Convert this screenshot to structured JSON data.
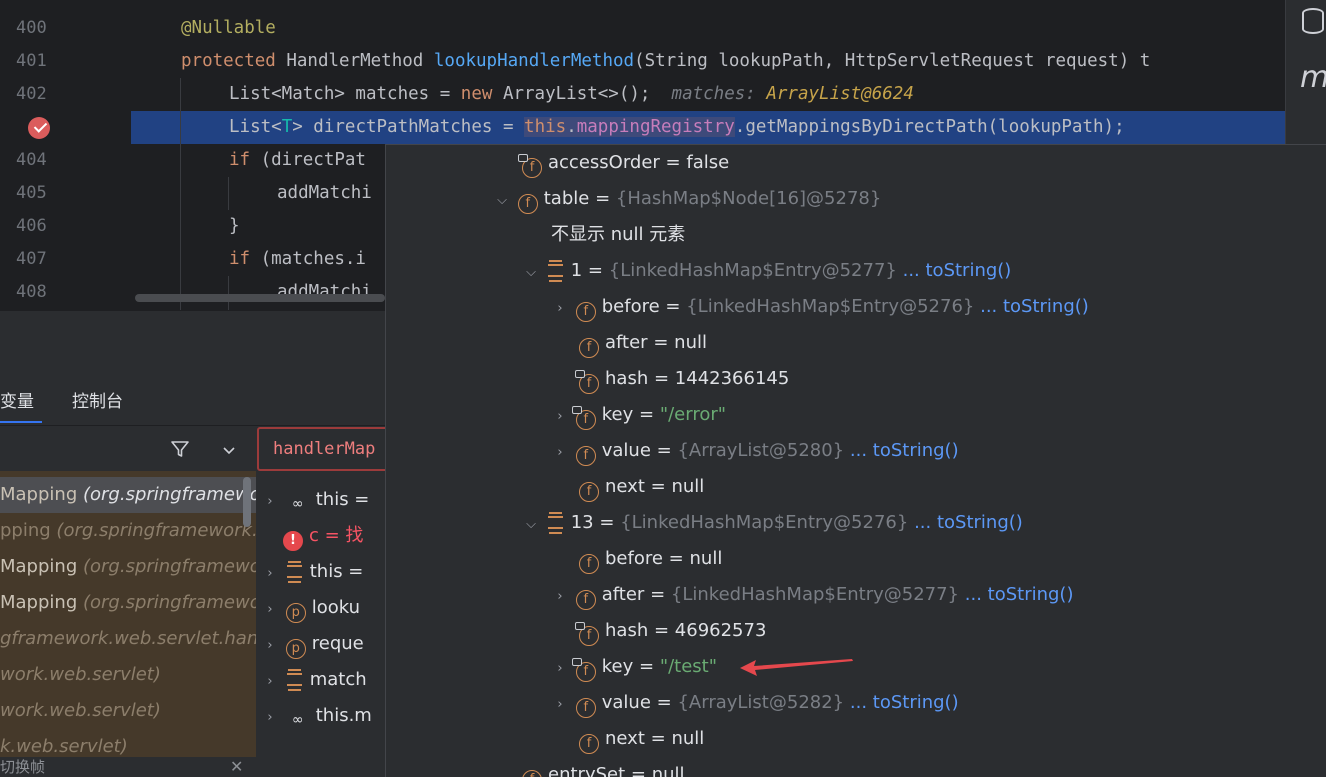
{
  "editor": {
    "lines": [
      {
        "no": "400"
      },
      {
        "no": "401"
      },
      {
        "no": "402"
      },
      {
        "no": "403"
      },
      {
        "no": "404"
      },
      {
        "no": "405"
      },
      {
        "no": "406"
      },
      {
        "no": "407"
      },
      {
        "no": "408"
      }
    ],
    "code": {
      "l400": "@Nullable",
      "l401_kw": "protected",
      "l401_type": " HandlerMethod ",
      "l401_fn": "lookupHandlerMethod",
      "l401_rest": "(String lookupPath, HttpServletRequest request) t",
      "l402_a": "List<Match> matches = ",
      "l402_kw": "new",
      "l402_b": " ArrayList<>();",
      "l402_hint": "matches: ",
      "l402_hintv": "ArrayList@6624",
      "l403_a": "List<",
      "l403_t": "T",
      "l403_b": "> directPathMatches = ",
      "l403_this": "this",
      "l403_dot": ".",
      "l403_fld": "mappingRegistry",
      "l403_c": ".getMappingsByDirectPath(lookupPath);",
      "l404_kw": "if",
      "l404_b": " (directPat",
      "l405": "addMatchi",
      "l406": "}",
      "l407_kw": "if",
      "l407_b": " (matches.i",
      "l408": "addMatchi"
    }
  },
  "debug": {
    "tab_variables": "变量",
    "tab_console": "控制台",
    "eval_expression": "handlerMap",
    "frames": [
      {
        "method": "Mapping",
        "pkg": "(org.springframewor",
        "selected": true
      },
      {
        "method": "pping",
        "pkg": "(org.springframework.we",
        "selected": false
      },
      {
        "method": "Mapping",
        "pkg": "(org.springframewo",
        "selected": false
      },
      {
        "method": "Mapping",
        "pkg": "(org.springframewor",
        "selected": false
      },
      {
        "method": "",
        "pkg": "gframework.web.servlet.handle",
        "selected": false
      },
      {
        "method": "",
        "pkg": "work.web.servlet)",
        "selected": false
      },
      {
        "method": "",
        "pkg": "work.web.servlet)",
        "selected": false
      },
      {
        "method": "",
        "pkg": "k.web.servlet)",
        "selected": false
      }
    ],
    "frames_footer": "切换帧",
    "variables": [
      {
        "icon": "glasses-icon",
        "text": "this ="
      },
      {
        "icon": "error-icon",
        "text": "c = 找"
      },
      {
        "icon": "array-icon",
        "text": "this ="
      },
      {
        "icon": "param-icon",
        "text": "looku"
      },
      {
        "icon": "param-icon",
        "text": "reque"
      },
      {
        "icon": "array-icon",
        "text": "match"
      },
      {
        "icon": "glasses-icon",
        "text": "this.m"
      }
    ]
  },
  "popup": {
    "access_order": {
      "name": "accessOrder",
      "value": "false"
    },
    "table": {
      "name": "table",
      "type": "{HashMap$Node[16]@5278}"
    },
    "null_note": "不显示 null 元素",
    "entry1": {
      "index": "1",
      "type": "{LinkedHashMap$Entry@5277}",
      "link": "... toString()"
    },
    "entry1_before": {
      "name": "before",
      "type": "{LinkedHashMap$Entry@5276}",
      "link": "... toString()"
    },
    "entry1_after": {
      "name": "after",
      "value": "null"
    },
    "entry1_hash": {
      "name": "hash",
      "value": "1442366145"
    },
    "entry1_key": {
      "name": "key",
      "value": "\"/error\""
    },
    "entry1_value": {
      "name": "value",
      "type": "{ArrayList@5280}",
      "link": "... toString()"
    },
    "entry1_next": {
      "name": "next",
      "value": "null"
    },
    "entry13": {
      "index": "13",
      "type": "{LinkedHashMap$Entry@5276}",
      "link": "... toString()"
    },
    "entry13_before": {
      "name": "before",
      "value": "null"
    },
    "entry13_after": {
      "name": "after",
      "type": "{LinkedHashMap$Entry@5277}",
      "link": "... toString()"
    },
    "entry13_hash": {
      "name": "hash",
      "value": "46962573"
    },
    "entry13_key": {
      "name": "key",
      "value": "\"/test\""
    },
    "entry13_value": {
      "name": "value",
      "type": "{ArrayList@5282}",
      "link": "... toString()"
    },
    "entry13_next": {
      "name": "next",
      "value": "null"
    },
    "entry_set": {
      "name": "entrySet",
      "value": "null"
    },
    "eq": "=",
    "expanded_glyph": "⌵",
    "collapsed_glyph": "›"
  },
  "colors": {
    "execution_line": "#214283",
    "annotation_arrow": "#e5484d",
    "field_icon": "#d08b53"
  }
}
